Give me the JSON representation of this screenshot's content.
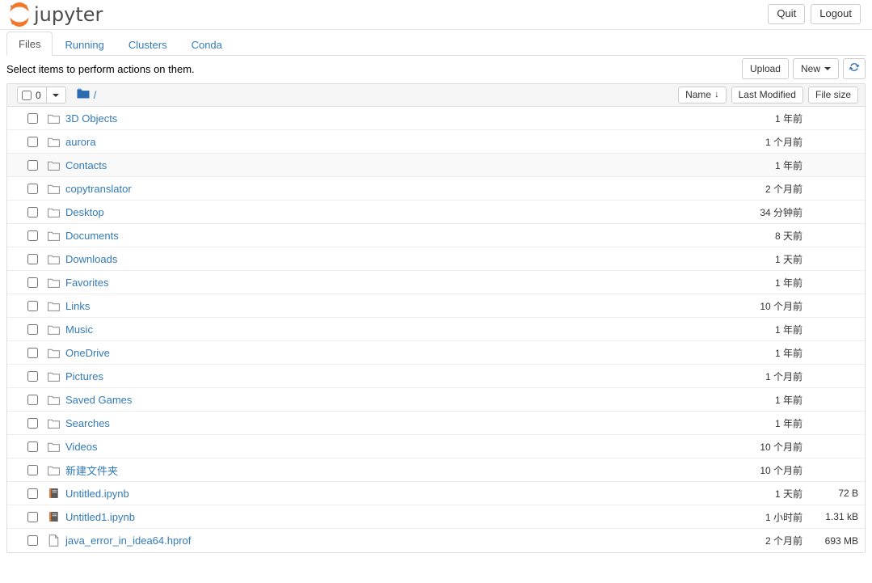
{
  "header": {
    "brand_text": "jupyter",
    "brand_logo_icon": "jupyter-logo",
    "quit_label": "Quit",
    "logout_label": "Logout"
  },
  "tabs": [
    {
      "label": "Files",
      "active": true
    },
    {
      "label": "Running",
      "active": false
    },
    {
      "label": "Clusters",
      "active": false
    },
    {
      "label": "Conda",
      "active": false
    }
  ],
  "toolbar": {
    "message": "Select items to perform actions on them.",
    "upload_label": "Upload",
    "new_label": "New",
    "refresh_icon": "refresh-icon"
  },
  "list_header": {
    "selected_count": "0",
    "dropdown_icon": "chevron-down-icon",
    "folder_icon": "folder-open-icon",
    "breadcrumb_root": "/",
    "col_name": "Name",
    "col_name_sort_icon": "↓",
    "col_modified": "Last Modified",
    "col_size": "File size"
  },
  "rows": [
    {
      "icon": "folder-icon",
      "name": "3D Objects",
      "modified": "1 年前",
      "size": ""
    },
    {
      "icon": "folder-icon",
      "name": "aurora",
      "modified": "1 个月前",
      "size": ""
    },
    {
      "icon": "folder-icon",
      "name": "Contacts",
      "modified": "1 年前",
      "size": "",
      "hovered": true
    },
    {
      "icon": "folder-icon",
      "name": "copytranslator",
      "modified": "2 个月前",
      "size": ""
    },
    {
      "icon": "folder-icon",
      "name": "Desktop",
      "modified": "34 分钟前",
      "size": ""
    },
    {
      "icon": "folder-icon",
      "name": "Documents",
      "modified": "8 天前",
      "size": ""
    },
    {
      "icon": "folder-icon",
      "name": "Downloads",
      "modified": "1 天前",
      "size": ""
    },
    {
      "icon": "folder-icon",
      "name": "Favorites",
      "modified": "1 年前",
      "size": ""
    },
    {
      "icon": "folder-icon",
      "name": "Links",
      "modified": "10 个月前",
      "size": ""
    },
    {
      "icon": "folder-icon",
      "name": "Music",
      "modified": "1 年前",
      "size": ""
    },
    {
      "icon": "folder-icon",
      "name": "OneDrive",
      "modified": "1 年前",
      "size": ""
    },
    {
      "icon": "folder-icon",
      "name": "Pictures",
      "modified": "1 个月前",
      "size": ""
    },
    {
      "icon": "folder-icon",
      "name": "Saved Games",
      "modified": "1 年前",
      "size": ""
    },
    {
      "icon": "folder-icon",
      "name": "Searches",
      "modified": "1 年前",
      "size": ""
    },
    {
      "icon": "folder-icon",
      "name": "Videos",
      "modified": "10 个月前",
      "size": ""
    },
    {
      "icon": "folder-icon",
      "name": "新建文件夹",
      "modified": "10 个月前",
      "size": ""
    },
    {
      "icon": "notebook-icon",
      "name": "Untitled.ipynb",
      "modified": "1 天前",
      "size": "72 B"
    },
    {
      "icon": "notebook-icon",
      "name": "Untitled1.ipynb",
      "modified": "1 小时前",
      "size": "1.31 kB"
    },
    {
      "icon": "file-icon",
      "name": "java_error_in_idea64.hprof",
      "modified": "2 个月前",
      "size": "693 MB"
    }
  ],
  "colors": {
    "link": "#337ab7",
    "brand_orange": "#f37726",
    "folder_blue": "#2b6cb0",
    "border": "#dddddd"
  }
}
